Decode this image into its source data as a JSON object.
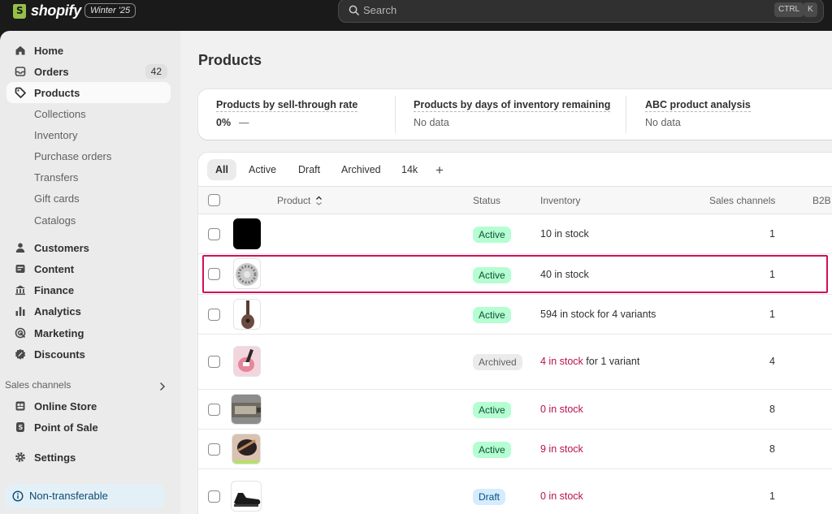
{
  "topbar": {
    "logo_text": "shopify",
    "edition_badge": "Winter '25",
    "search_placeholder": "Search",
    "shortcut_ctrl": "CTRL",
    "shortcut_k": "K"
  },
  "sidebar": {
    "items": [
      {
        "label": "Home",
        "icon": "home-icon"
      },
      {
        "label": "Orders",
        "icon": "orders-icon",
        "count": "42"
      },
      {
        "label": "Products",
        "icon": "tag-icon",
        "active": true
      },
      {
        "label": "Collections",
        "sub": true
      },
      {
        "label": "Inventory",
        "sub": true
      },
      {
        "label": "Purchase orders",
        "sub": true
      },
      {
        "label": "Transfers",
        "sub": true
      },
      {
        "label": "Gift cards",
        "sub": true
      },
      {
        "label": "Catalogs",
        "sub": true
      },
      {
        "label": "Customers",
        "icon": "person-icon"
      },
      {
        "label": "Content",
        "icon": "content-icon"
      },
      {
        "label": "Finance",
        "icon": "bank-icon"
      },
      {
        "label": "Analytics",
        "icon": "bar-chart-icon"
      },
      {
        "label": "Marketing",
        "icon": "target-icon"
      },
      {
        "label": "Discounts",
        "icon": "discount-icon"
      }
    ],
    "sales_channels_title": "Sales channels",
    "channels": [
      {
        "label": "Online Store",
        "icon": "store-icon"
      },
      {
        "label": "Point of Sale",
        "icon": "pos-icon"
      }
    ],
    "settings_label": "Settings",
    "notice_label": "Non-transferable"
  },
  "main": {
    "title": "Products",
    "metrics": [
      {
        "title": "Products by sell-through rate",
        "value": "0%",
        "trend": "—"
      },
      {
        "title": "Products by days of inventory remaining",
        "value": "No data"
      },
      {
        "title": "ABC product analysis",
        "value": "No data"
      }
    ],
    "tabs": [
      "All",
      "Active",
      "Draft",
      "Archived",
      "14k"
    ],
    "add_tab_label": "+",
    "columns": {
      "product": "Product",
      "status": "Status",
      "inventory": "Inventory",
      "sales_channels": "Sales channels",
      "b2b": "B2B"
    },
    "rows": [
      {
        "status": "Active",
        "inventory_a": "10 in stock",
        "inventory_b": "",
        "channels": "1",
        "thumb": "black-square"
      },
      {
        "status": "Active",
        "inventory_a": "40 in stock",
        "inventory_b": "",
        "channels": "1",
        "thumb": "grey-circle"
      },
      {
        "status": "Active",
        "inventory_a": "594 in stock for 4 variants",
        "inventory_b": "",
        "channels": "1",
        "thumb": "guitar-dark"
      },
      {
        "status": "Archived",
        "inventory_a": "4 in stock",
        "inventory_b": " for 1 variant",
        "channels": "4",
        "thumb": "guitar-pink",
        "warn": true
      },
      {
        "status": "Active",
        "inventory_a": "0 in stock",
        "inventory_b": "",
        "channels": "8",
        "thumb": "device",
        "warn": true
      },
      {
        "status": "Active",
        "inventory_a": "9 in stock",
        "inventory_b": "",
        "channels": "8",
        "thumb": "hand",
        "warn": true
      },
      {
        "status": "Draft",
        "inventory_a": "0 in stock",
        "inventory_b": "",
        "channels": "1",
        "thumb": "shoe",
        "warn": true
      }
    ]
  }
}
